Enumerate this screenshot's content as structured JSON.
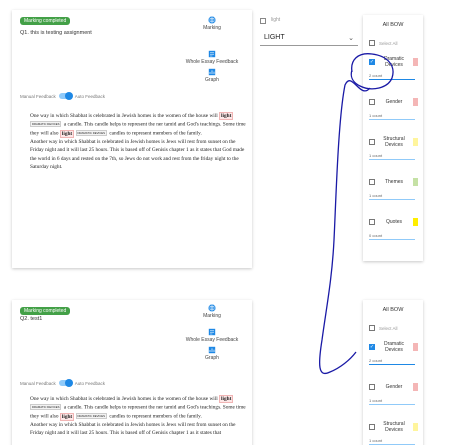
{
  "colors": {
    "badge": "#43a047",
    "accent": "#1e88e5",
    "ink": "#1a1aa6"
  },
  "assignment1": {
    "badge": "Marking completed",
    "question": "Q1. this is testing assignment",
    "tools": {
      "marking": "Marking",
      "whole_essay": "Whole Essay Feedback",
      "graph": "Graph"
    },
    "toggle": {
      "left": "Manual Feedback",
      "right": "Auto Feedback"
    },
    "essay": {
      "p1a": "One way in which Shabbat is celebrated in Jewish homes is the women of the house will",
      "hl1": "light",
      "tag1": "DRAMATIC DEVICES",
      "p1b": "a candle. This candle helps to represent the ner tamid and God's teachings. Some time they will also",
      "hl2": "light",
      "tag2": "DRAMATIC DEVICES",
      "p1c": "candles to represent members of the family.",
      "p2": "Another way in which Shabbat is celebrated in Jewish homes is Jews will rest from sunset on the Friday night and it will last 25 hours. This is based off of Genisis chapter 1 as it states that God made the world in 6 days and rested on the 7th, so Jews do not work and rest from the friday night to the Saturday night."
    }
  },
  "assignment2": {
    "badge": "Marking completed",
    "question": "Q2. test1",
    "tools": {
      "marking": "Marking",
      "whole_essay": "Whole Essay Feedback",
      "graph": "Graph"
    },
    "toggle": {
      "left": "Manual Feedback",
      "right": "Auto Feedback"
    },
    "essay": {
      "p1a": "One way in which Shabbat is celebrated in Jewish homes is the women of the house will",
      "hl1": "light",
      "tag1": "DRAMATIC DEVICES",
      "p1b": "a candle. This candle helps to represent the ner tamid and God's teachings. Some time they will also",
      "hl2": "light",
      "tag2": "DRAMATIC DEVICES",
      "p1c": "candles to represent members of the family.",
      "p2": "Another way in which Shabbat is celebrated in Jewish homes is Jews will rest from sunset on the Friday night and it will last 25 hours. This is based off of Genisis chapter 1 as it states that"
    }
  },
  "filter": {
    "label": "light",
    "selected": "LIGHT",
    "chevron": "⌄"
  },
  "panel1": {
    "title": "All BOW",
    "select_all": "Select All",
    "categories": [
      {
        "name": "Dramatic Devices",
        "count": "2 count",
        "color": "#f4b6b6",
        "checked": true
      },
      {
        "name": "Gender",
        "count": "1 count",
        "color": "#f4b6b6",
        "checked": false
      },
      {
        "name": "Structural Devices",
        "count": "1 count",
        "color": "#fff59d",
        "checked": false
      },
      {
        "name": "Themes",
        "count": "1 count",
        "color": "#c5e1a5",
        "checked": false
      },
      {
        "name": "Quotes",
        "count": "0 count",
        "color": "#ffee00",
        "checked": false
      }
    ]
  },
  "panel2": {
    "title": "All BOW",
    "select_all": "Select All",
    "categories": [
      {
        "name": "Dramatic Devices",
        "count": "2 count",
        "color": "#f4b6b6",
        "checked": true
      },
      {
        "name": "Gender",
        "count": "1 count",
        "color": "#f4b6b6",
        "checked": false
      },
      {
        "name": "Structural Devices",
        "count": "1 count",
        "color": "#fff59d",
        "checked": false
      }
    ]
  }
}
